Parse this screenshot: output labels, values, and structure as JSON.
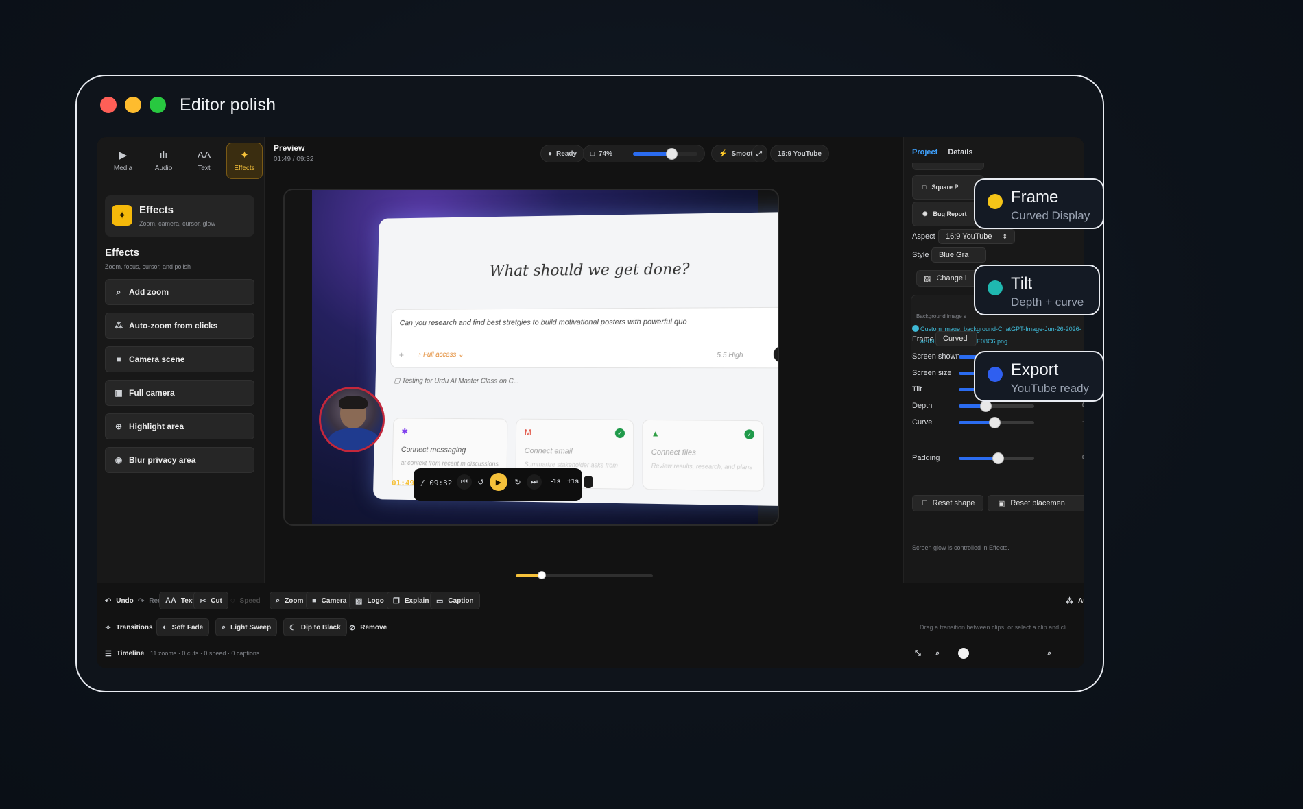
{
  "window": {
    "title": "Editor polish"
  },
  "left_tabs": [
    {
      "label": "Media",
      "icon": "play-square-icon"
    },
    {
      "label": "Audio",
      "icon": "waveform-icon"
    },
    {
      "label": "Text",
      "icon": "text-aa-icon"
    },
    {
      "label": "Effects",
      "icon": "sparkle-icon",
      "active": true
    }
  ],
  "effects_card": {
    "title": "Effects",
    "subtitle": "Zoom, camera, cursor, glow"
  },
  "effects_section": {
    "title": "Effects",
    "subtitle": "Zoom, focus, cursor, and polish"
  },
  "effects_buttons": [
    {
      "label": "Add zoom",
      "icon": "zoom-icon"
    },
    {
      "label": "Auto-zoom from clicks",
      "icon": "cursor-click-icon"
    },
    {
      "label": "Camera scene",
      "icon": "camera-icon"
    },
    {
      "label": "Full camera",
      "icon": "full-camera-icon"
    },
    {
      "label": "Highlight area",
      "icon": "crosshair-icon"
    },
    {
      "label": "Blur privacy area",
      "icon": "eye-off-icon"
    }
  ],
  "preview": {
    "title": "Preview",
    "time": "01:49 / 09:32",
    "status": "Ready",
    "zoom": "74%",
    "zoom_level": 0.6,
    "motion": "Smooth",
    "aspect_chip": "16:9 YouTube"
  },
  "canvas": {
    "heading": "What should we get done?",
    "prompt": "Can you research and find best stretgies to build motivational posters with powerful quo",
    "access": "Full access",
    "model": "5.5  High",
    "testing": "Testing for Urdu AI Master Class on C...",
    "cards": [
      {
        "title": "Connect messaging",
        "sub": "at context from recent m discussions"
      },
      {
        "title": "Connect email",
        "sub": "Summarize stakeholder asks from email"
      },
      {
        "title": "Connect files",
        "sub": "Review results, research, and plans"
      }
    ]
  },
  "transport": {
    "current": "01:49",
    "total": "/ 09:32",
    "back": "-1s",
    "fwd": "+1s",
    "progress": 0.19
  },
  "right_panel": {
    "tabs": [
      "Project",
      "Details"
    ],
    "buttons": [
      "Square P",
      "Bug Report"
    ],
    "aspect_label": "Aspect",
    "aspect_value": "16:9 YouTube",
    "style_label": "Style",
    "style_value": "Blue Gra",
    "change_label": "Change i",
    "custom_image": "Custom image: background-ChatGPT-Image-Jun-26-2026-at-09-35-54-AM-77BE08C6.png",
    "bg_note": "Background image s",
    "frame_label": "Frame",
    "frame_value": "Curved",
    "sliders": [
      {
        "label": "Screen shown",
        "value": "",
        "level": 0.47
      },
      {
        "label": "Screen size",
        "value": "1",
        "level": 0.6
      },
      {
        "label": "Tilt",
        "value": "-0",
        "level": 0.42
      },
      {
        "label": "Depth",
        "value": "0",
        "level": 0.36
      },
      {
        "label": "Curve",
        "value": "-0",
        "level": 0.48
      }
    ],
    "reset_shape": "Reset shape",
    "reset_placement": "Reset placemen",
    "padding_label": "Padding",
    "padding_value": "0",
    "padding_level": 0.52,
    "glow_note": "Screen glow is controlled in Effects."
  },
  "toolbar": {
    "undo": "Undo",
    "redo": "Redo",
    "text": "Text",
    "cut": "Cut",
    "speed": "Speed",
    "zoom": "Zoom",
    "camera": "Camera",
    "logo": "Logo",
    "explain": "Explain",
    "caption": "Caption",
    "auto": "Auto"
  },
  "transitions": {
    "label": "Transitions",
    "soft_fade": "Soft Fade",
    "light_sweep": "Light Sweep",
    "dip_black": "Dip to Black",
    "remove": "Remove",
    "hint": "Drag a transition between clips, or select a clip and cli"
  },
  "timeline": {
    "label": "Timeline",
    "stats": "11 zooms · 0 cuts · 0 speed · 0 captions"
  },
  "callouts": [
    {
      "title": "Frame",
      "sub": "Curved Display",
      "color": "#f5c518"
    },
    {
      "title": "Tilt",
      "sub": "Depth + curve",
      "color": "#1fb8b0"
    },
    {
      "title": "Export",
      "sub": "YouTube ready",
      "color": "#2f5ff0"
    }
  ],
  "colors": {
    "accent": "#f5c13a",
    "slider": "#2b6cf0",
    "link": "#3fa2ff"
  }
}
